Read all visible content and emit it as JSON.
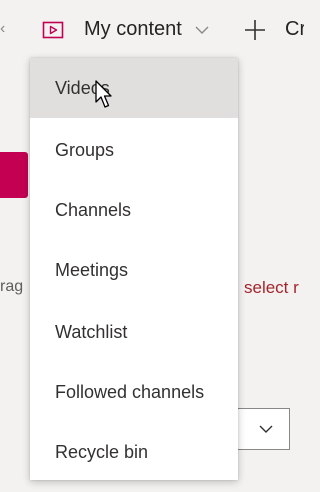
{
  "topbar": {
    "left_glyph": "‹",
    "content_icon": "video-content-icon",
    "my_content_label": "My content",
    "chevron_icon": "chevron-down-icon",
    "plus_icon": "plus-icon",
    "create_label": "Cr"
  },
  "background": {
    "left_partial_text": "rag",
    "right_partial_link": "select r",
    "accent_color": "#c30052",
    "link_color": "#a4262c"
  },
  "menu": {
    "items": [
      {
        "label": "Videos",
        "highlighted": true
      },
      {
        "label": "Groups"
      },
      {
        "label": "Channels"
      },
      {
        "label": "Meetings"
      },
      {
        "label": "Watchlist"
      },
      {
        "label": "Followed channels"
      },
      {
        "label": "Recycle bin"
      }
    ]
  },
  "cursor": {
    "icon": "mouse-pointer-icon"
  }
}
